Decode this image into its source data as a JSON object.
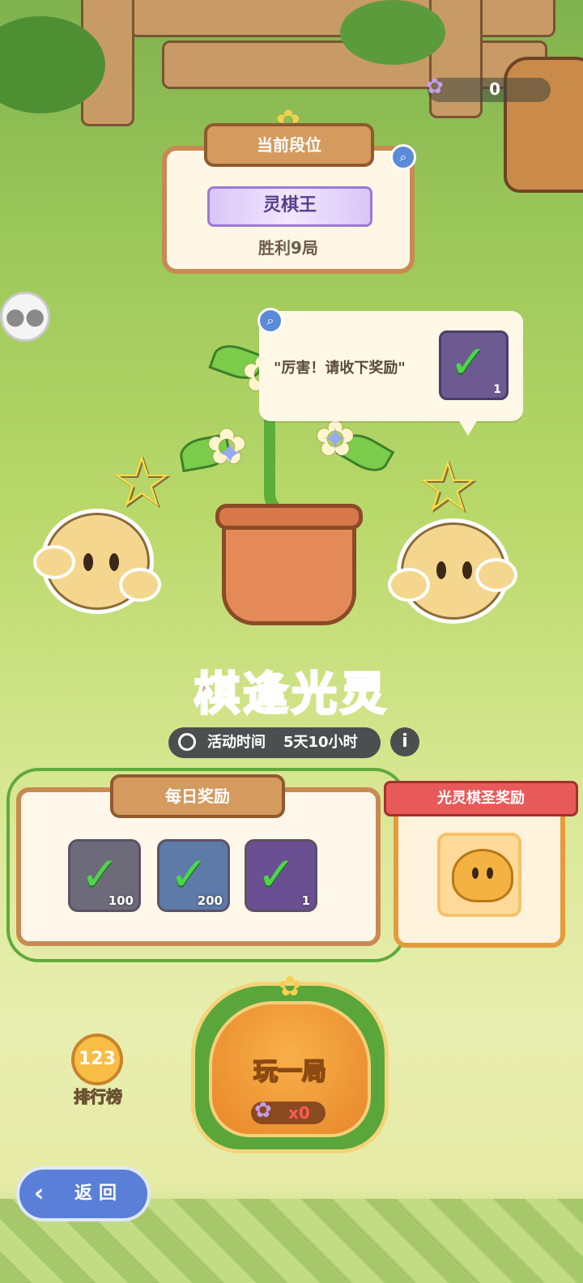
{
  "currency": {
    "icon": "lotus-gem-icon",
    "value": "0"
  },
  "rank_card": {
    "header": "当前段位",
    "rank_name": "灵棋王",
    "wins": "胜利9局"
  },
  "speech_bubble": {
    "text": "\"厉害！请收下奖励\"",
    "reward_count": "1"
  },
  "event": {
    "title": "棋逢光灵",
    "time_label": "活动时间",
    "time_value": "5天10小时"
  },
  "daily_rewards": {
    "header": "每日奖励",
    "items": [
      {
        "icon": "crystal-star-icon",
        "count": "100",
        "claimed": true
      },
      {
        "icon": "blue-crystal-icon",
        "count": "200",
        "claimed": true
      },
      {
        "icon": "purple-orb-icon",
        "count": "1",
        "claimed": true
      }
    ]
  },
  "grand_reward": {
    "header": "光灵棋圣奖励",
    "icon": "orange-spirit-icon"
  },
  "leaderboard": {
    "label": "排行榜",
    "medal": "123"
  },
  "play": {
    "label": "玩一局",
    "cost": "x0"
  },
  "back": {
    "label": "返回"
  }
}
